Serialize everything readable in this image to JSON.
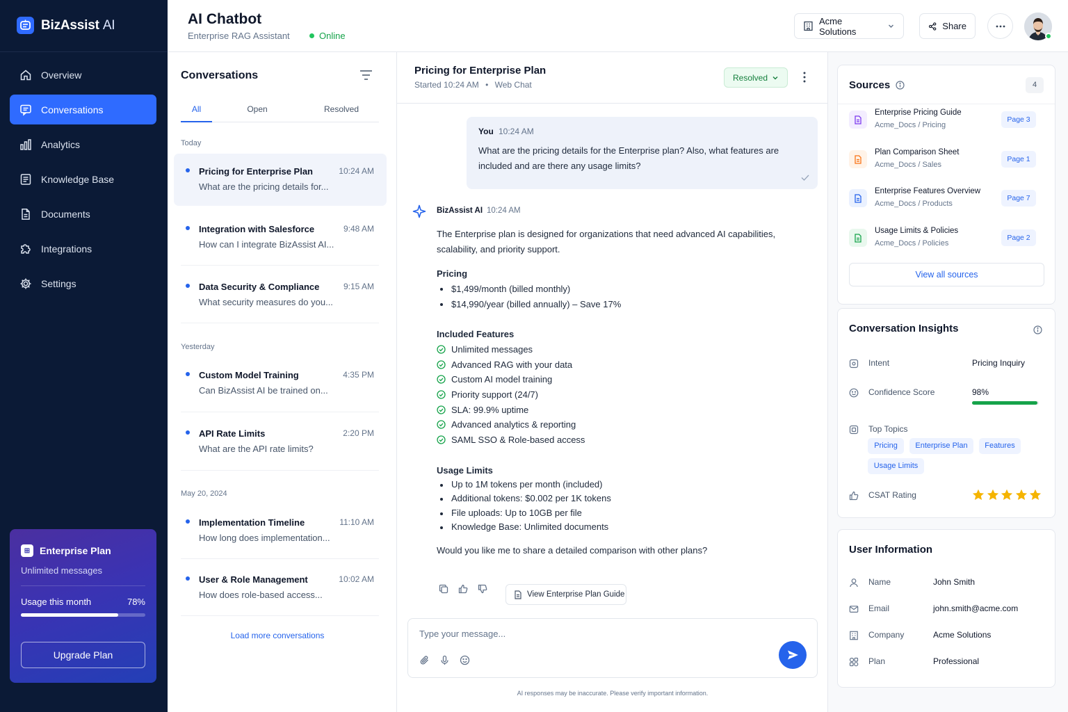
{
  "app": {
    "name": "BizAssist",
    "name_suffix": "AI"
  },
  "sidebar": {
    "items": [
      {
        "label": "Overview",
        "icon": "home-icon"
      },
      {
        "label": "Conversations",
        "icon": "chat-icon",
        "active": true
      },
      {
        "label": "Analytics",
        "icon": "bar-chart-icon"
      },
      {
        "label": "Knowledge Base",
        "icon": "book-icon"
      },
      {
        "label": "Documents",
        "icon": "file-icon"
      },
      {
        "label": "Integrations",
        "icon": "puzzle-icon"
      },
      {
        "label": "Settings",
        "icon": "gear-icon"
      }
    ],
    "plan": {
      "title": "Enterprise Plan",
      "subtitle": "Unlimited messages",
      "usage_label": "Usage this month",
      "usage_value": "78%",
      "usage_fraction": 0.78,
      "upgrade_label": "Upgrade Plan"
    }
  },
  "header": {
    "title": "AI Chatbot",
    "subtitle": "Enterprise RAG Assistant",
    "status": "Online",
    "org": "Acme Solutions",
    "share": "Share"
  },
  "conversations": {
    "title": "Conversations",
    "tabs": [
      "All",
      "Open",
      "Resolved"
    ],
    "groups": [
      {
        "label": "Today",
        "items": [
          {
            "title": "Pricing for Enterprise Plan",
            "time": "10:24 AM",
            "preview": "What are the pricing details for...",
            "active": true
          },
          {
            "title": "Integration with Salesforce",
            "time": "9:48 AM",
            "preview": "How can I integrate BizAssist AI..."
          },
          {
            "title": "Data Security & Compliance",
            "time": "9:15 AM",
            "preview": "What security measures do you..."
          }
        ]
      },
      {
        "label": "Yesterday",
        "items": [
          {
            "title": "Custom Model Training",
            "time": "4:35 PM",
            "preview": "Can BizAssist AI be trained on..."
          },
          {
            "title": "API Rate Limits",
            "time": "2:20 PM",
            "preview": "What are the API rate limits?"
          }
        ]
      },
      {
        "label": "May 20, 2024",
        "items": [
          {
            "title": "Implementation Timeline",
            "time": "11:10 AM",
            "preview": "How long does implementation..."
          },
          {
            "title": "User & Role Management",
            "time": "10:02 AM",
            "preview": "How does role-based access..."
          }
        ]
      }
    ],
    "load_more": "Load more conversations"
  },
  "chat": {
    "title": "Pricing for Enterprise Plan",
    "started": "Started 10:24 AM",
    "channel": "Web Chat",
    "status": "Resolved",
    "user_msg": {
      "who": "You",
      "time": "10:24 AM",
      "text": "What are the pricing details for the Enterprise plan? Also, what features are included and are there any usage limits?"
    },
    "bot_msg": {
      "who": "BizAssist AI",
      "time": "10:24 AM",
      "intro": "The Enterprise plan is designed for organizations that need advanced AI capabilities, scalability, and priority support.",
      "pricing_title": "Pricing",
      "pricing": [
        "$1,499/month (billed monthly)",
        "$14,990/year (billed annually) – Save 17%"
      ],
      "features_title": "Included Features",
      "features": [
        "Unlimited messages",
        "Advanced RAG with your data",
        "Custom AI model training",
        "Priority support (24/7)",
        "SLA: 99.9% uptime",
        "Advanced analytics & reporting",
        "SAML SSO & Role-based access"
      ],
      "limits_title": "Usage Limits",
      "limits": [
        "Up to 1M tokens per month (included)",
        "Additional tokens: $0.002 per 1K tokens",
        "File uploads: Up to 10GB per file",
        "Knowledge Base: Unlimited documents"
      ],
      "closing": "Would you like me to share a detailed comparison with other plans?",
      "guide_button": "View Enterprise Plan Guide"
    },
    "composer_placeholder": "Type your message...",
    "disclaimer": "AI responses may be inaccurate. Please verify important information."
  },
  "sources": {
    "title": "Sources",
    "count": "4",
    "items": [
      {
        "name": "Enterprise Pricing Guide",
        "path": "Acme_Docs / Pricing",
        "page": "Page 3",
        "color": "#7c3aed",
        "bg": "#f3edff"
      },
      {
        "name": "Plan Comparison Sheet",
        "path": "Acme_Docs / Sales",
        "page": "Page 1",
        "color": "#f97316",
        "bg": "#fff3e8"
      },
      {
        "name": "Enterprise Features Overview",
        "path": "Acme_Docs / Products",
        "page": "Page 7",
        "color": "#2563eb",
        "bg": "#eaf1ff"
      },
      {
        "name": "Usage Limits & Policies",
        "path": "Acme_Docs / Policies",
        "page": "Page 2",
        "color": "#16a34a",
        "bg": "#e9f8ee"
      }
    ],
    "view_all": "View all sources"
  },
  "insights": {
    "title": "Conversation Insights",
    "intent_label": "Intent",
    "intent_value": "Pricing Inquiry",
    "confidence_label": "Confidence Score",
    "confidence_value": "98%",
    "confidence_fraction": 0.98,
    "topics_label": "Top Topics",
    "topics": [
      "Pricing",
      "Enterprise Plan",
      "Features",
      "Usage Limits"
    ],
    "csat_label": "CSAT Rating",
    "csat_stars": 5
  },
  "user_info": {
    "title": "User Information",
    "rows": [
      {
        "label": "Name",
        "value": "John Smith",
        "icon": "user-icon"
      },
      {
        "label": "Email",
        "value": "john.smith@acme.com",
        "icon": "mail-icon"
      },
      {
        "label": "Company",
        "value": "Acme Solutions",
        "icon": "building-icon"
      },
      {
        "label": "Plan",
        "value": "Professional",
        "icon": "plan-icon"
      }
    ]
  }
}
